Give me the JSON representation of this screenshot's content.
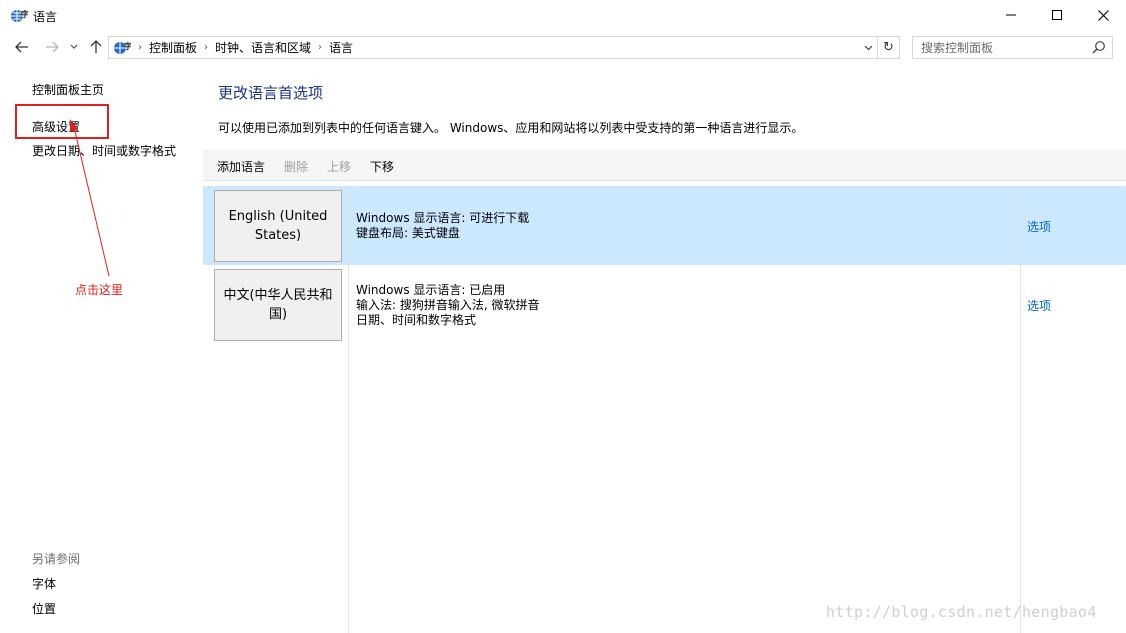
{
  "window": {
    "title": "语言",
    "controls": [
      "minimize-icon",
      "maximize-icon",
      "close-icon"
    ]
  },
  "nav": {
    "breadcrumb": [
      "控制面板",
      "时钟、语言和区域",
      "语言"
    ],
    "search_placeholder": "搜索控制面板"
  },
  "sidebar": {
    "links": [
      {
        "label": "控制面板主页"
      },
      {
        "label": "高级设置"
      },
      {
        "label": "更改日期、时间或数字格式"
      }
    ],
    "see_also_label": "另请参阅",
    "see_also": [
      {
        "label": "字体"
      },
      {
        "label": "位置"
      }
    ]
  },
  "annotation": {
    "text": "点击这里",
    "color": "#e0201c"
  },
  "main": {
    "title": "更改语言首选项",
    "description": "可以使用已添加到列表中的任何语言键入。 Windows、应用和网站将以列表中受支持的第一种语言进行显示。",
    "toolbar": {
      "add": "添加语言",
      "remove": "删除",
      "up": "上移",
      "down": "下移"
    },
    "languages": [
      {
        "name": "English (United States)",
        "details": [
          "Windows 显示语言: 可进行下载",
          "键盘布局: 美式键盘"
        ],
        "options": "选项",
        "selected": true
      },
      {
        "name": "中文(中华人民共和国)",
        "details": [
          "Windows 显示语言: 已启用",
          "输入法: 搜狗拼音输入法, 微软拼音",
          "日期、时间和数字格式"
        ],
        "options": "选项",
        "selected": false
      }
    ]
  },
  "watermark": "http://blog.csdn.net/hengbao4",
  "colors": {
    "accent_link": "#0066cc",
    "title_blue": "#1e3287",
    "selection": "#cce8ff",
    "annotation_red": "#e0201c"
  }
}
